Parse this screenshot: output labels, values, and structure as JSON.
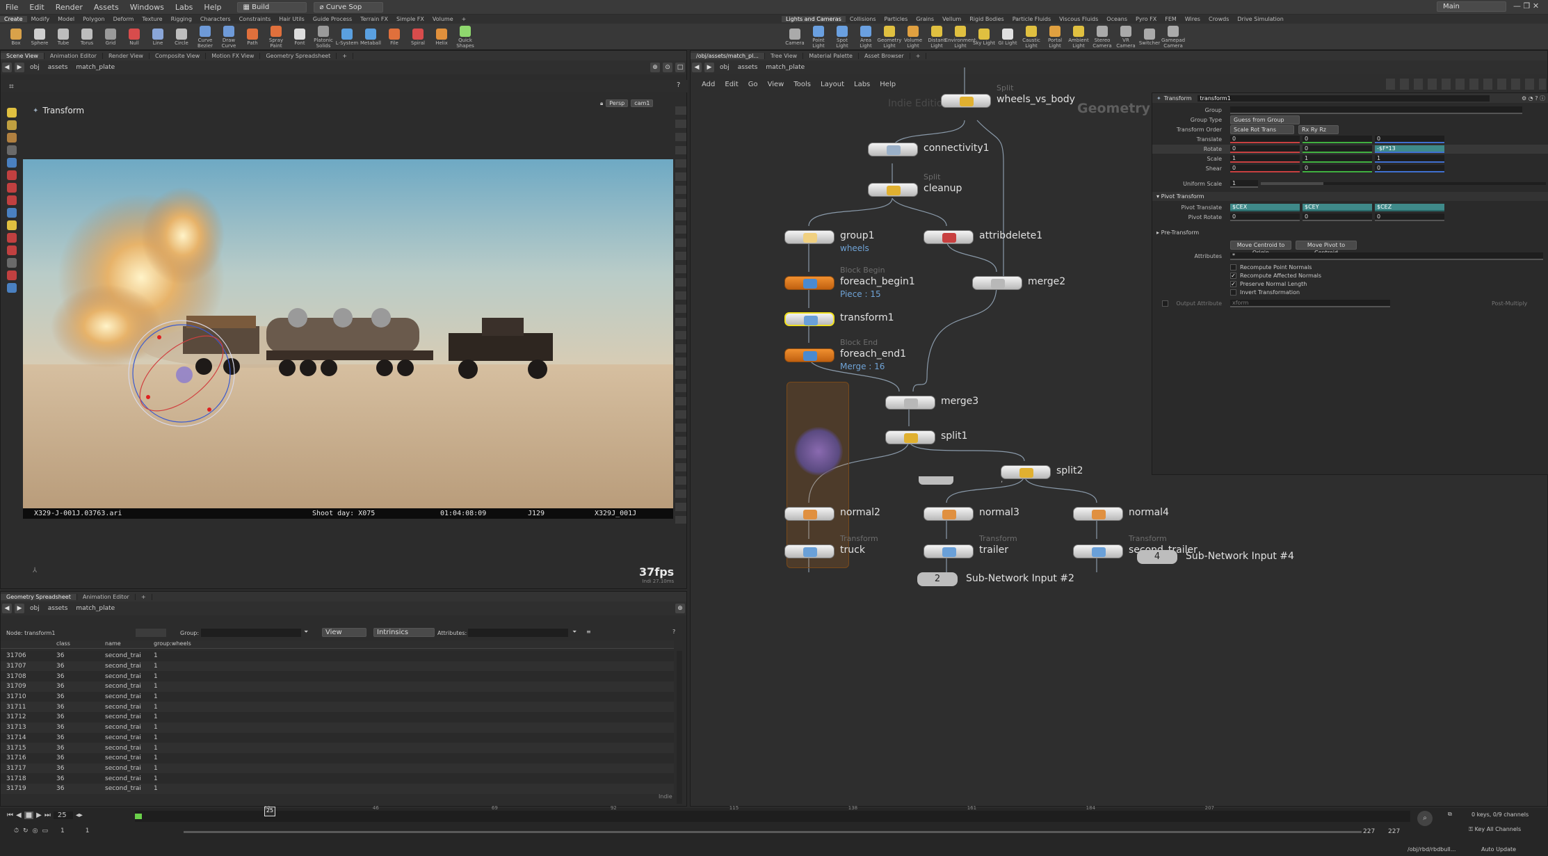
{
  "menubar": {
    "items": [
      "File",
      "Edit",
      "Render",
      "Assets",
      "Windows",
      "Labs",
      "Help"
    ],
    "build_label": "Build",
    "desk_label": "Curve Sop",
    "right_label": "Main"
  },
  "shelf": {
    "tabs_left": [
      "Create",
      "Modify",
      "Model",
      "Polygon",
      "Deform",
      "Texture",
      "Rigging",
      "Characters",
      "Constraints",
      "Hair Utils",
      "Guide Process",
      "Terrain FX",
      "Simple FX",
      "Volume"
    ],
    "tabs_right": [
      "Lights and Cameras",
      "Collisions",
      "Particles",
      "Grains",
      "Vellum",
      "Rigid Bodies",
      "Particle Fluids",
      "Viscous Fluids",
      "Oceans",
      "Pyro FX",
      "FEM",
      "Wires",
      "Crowds",
      "Drive Simulation"
    ],
    "tools_left": [
      {
        "label": "Box",
        "color": "#d9a24a"
      },
      {
        "label": "Sphere",
        "color": "#cfcfcf"
      },
      {
        "label": "Tube",
        "color": "#bdbdbd"
      },
      {
        "label": "Torus",
        "color": "#bdbdbd"
      },
      {
        "label": "Grid",
        "color": "#9a9a9a"
      },
      {
        "label": "Null",
        "color": "#d84c4c"
      },
      {
        "label": "Line",
        "color": "#8aa6d8"
      },
      {
        "label": "Circle",
        "color": "#bdbdbd"
      },
      {
        "label": "Curve Bezier",
        "color": "#6e9ad8"
      },
      {
        "label": "Draw Curve",
        "color": "#6e9ad8"
      },
      {
        "label": "Path",
        "color": "#e0703c"
      },
      {
        "label": "Spray Paint",
        "color": "#e0703c"
      },
      {
        "label": "Font",
        "color": "#dddddd"
      },
      {
        "label": "Platonic Solids",
        "color": "#9a9a9a"
      },
      {
        "label": "L-System",
        "color": "#5aa0e0"
      },
      {
        "label": "Metaball",
        "color": "#5aa0e0"
      },
      {
        "label": "File",
        "color": "#e0703c"
      },
      {
        "label": "Spiral",
        "color": "#d84c4c"
      },
      {
        "label": "Helix",
        "color": "#e0903c"
      },
      {
        "label": "Quick Shapes",
        "color": "#8fd86e"
      }
    ],
    "tools_right": [
      {
        "label": "Camera",
        "color": "#aaaaaa"
      },
      {
        "label": "Point Light",
        "color": "#6aa0e0"
      },
      {
        "label": "Spot Light",
        "color": "#6aa0e0"
      },
      {
        "label": "Area Light",
        "color": "#6aa0e0"
      },
      {
        "label": "Geometry Light",
        "color": "#e0c040"
      },
      {
        "label": "Volume Light",
        "color": "#e0a040"
      },
      {
        "label": "Distant Light",
        "color": "#e0c040"
      },
      {
        "label": "Environment Light",
        "color": "#e0c040"
      },
      {
        "label": "Sky Light",
        "color": "#e0c040"
      },
      {
        "label": "GI Light",
        "color": "#e0e0e0"
      },
      {
        "label": "Caustic Light",
        "color": "#e0c040"
      },
      {
        "label": "Portal Light",
        "color": "#e0a040"
      },
      {
        "label": "Ambient Light",
        "color": "#e0c040"
      },
      {
        "label": "Stereo Camera",
        "color": "#aaaaaa"
      },
      {
        "label": "VR Camera",
        "color": "#aaaaaa"
      },
      {
        "label": "Switcher",
        "color": "#aaaaaa"
      },
      {
        "label": "Gamepad Camera",
        "color": "#aaaaaa"
      }
    ]
  },
  "viewer": {
    "tabs": [
      "Scene View",
      "Animation Editor",
      "Render View",
      "Composite View",
      "Motion FX View",
      "Geometry Spreadsheet"
    ],
    "path": [
      "obj",
      "assets",
      "match_plate"
    ],
    "title": "Transform",
    "persp": "Persp",
    "cam": "cam1",
    "overlay_left": "X329-J-001J.03763.ari",
    "overlay_shootday": "Shoot day: X075",
    "overlay_timecode": "01:04:08:09",
    "overlay_j": "J129",
    "overlay_right": "X329J_001J",
    "fps": "37fps",
    "fps_sub1": "Indi",
    "fps_sub2": "27.10ms"
  },
  "spreadsheet": {
    "tabs": [
      "Geometry Spreadsheet",
      "Animation Editor"
    ],
    "path": [
      "obj",
      "assets",
      "match_plate"
    ],
    "node_label": "Node: transform1",
    "group_label": "Group:",
    "view_label": "View",
    "intrinsics_label": "Intrinsics",
    "attributes_label": "Attributes:",
    "columns": [
      "",
      "class",
      "name",
      "group:wheels"
    ],
    "rows": [
      [
        "31706",
        "36",
        "second_trai",
        "1"
      ],
      [
        "31707",
        "36",
        "second_trai",
        "1"
      ],
      [
        "31708",
        "36",
        "second_trai",
        "1"
      ],
      [
        "31709",
        "36",
        "second_trai",
        "1"
      ],
      [
        "31710",
        "36",
        "second_trai",
        "1"
      ],
      [
        "31711",
        "36",
        "second_trai",
        "1"
      ],
      [
        "31712",
        "36",
        "second_trai",
        "1"
      ],
      [
        "31713",
        "36",
        "second_trai",
        "1"
      ],
      [
        "31714",
        "36",
        "second_trai",
        "1"
      ],
      [
        "31715",
        "36",
        "second_trai",
        "1"
      ],
      [
        "31716",
        "36",
        "second_trai",
        "1"
      ],
      [
        "31717",
        "36",
        "second_trai",
        "1"
      ],
      [
        "31718",
        "36",
        "second_trai",
        "1"
      ],
      [
        "31719",
        "36",
        "second_trai",
        "1"
      ]
    ],
    "footer": "Indie"
  },
  "network": {
    "tabs": [
      "/obj/assets/match_pl...",
      "Tree View",
      "Material Palette",
      "Asset Browser"
    ],
    "path": [
      "obj",
      "assets",
      "match_plate"
    ],
    "menu": [
      "Add",
      "Edit",
      "Go",
      "View",
      "Tools",
      "Layout",
      "Labs",
      "Help"
    ],
    "watermark": "Indie Edition",
    "context": "Geometry",
    "nodes": [
      {
        "name": "wheels_vs_body",
        "type": "Split",
        "sub": "",
        "color": "#e0b030"
      },
      {
        "name": "connectivity1",
        "type": "",
        "sub": "",
        "color": "#9ab0c8"
      },
      {
        "name": "cleanup",
        "type": "Split",
        "sub": "",
        "color": "#e0b030"
      },
      {
        "name": "group1",
        "type": "",
        "sub": "wheels",
        "color": "#f0d080"
      },
      {
        "name": "attribdelete1",
        "type": "",
        "sub": "",
        "color": "#c84040"
      },
      {
        "name": "foreach_begin1",
        "type": "Block Begin",
        "sub": "Piece : 15",
        "color": "#4a8ad0"
      },
      {
        "name": "merge2",
        "type": "",
        "sub": "",
        "color": "#b8b8b8"
      },
      {
        "name": "transform1",
        "type": "",
        "sub": "",
        "color": "#6aa0d8"
      },
      {
        "name": "foreach_end1",
        "type": "Block End",
        "sub": "Merge : 16",
        "color": "#4a8ad0"
      },
      {
        "name": "merge3",
        "type": "",
        "sub": "",
        "color": "#b8b8b8"
      },
      {
        "name": "split1",
        "type": "",
        "sub": "",
        "color": "#e0b030"
      },
      {
        "name": "split2",
        "type": "",
        "sub": "",
        "color": "#e0b030"
      },
      {
        "name": "normal2",
        "type": "",
        "sub": "",
        "color": "#e09040"
      },
      {
        "name": "normal3",
        "type": "",
        "sub": "",
        "color": "#e09040"
      },
      {
        "name": "normal4",
        "type": "",
        "sub": "",
        "color": "#e09040"
      },
      {
        "name": "truck",
        "type": "Transform",
        "sub": "",
        "color": "#6aa0d8"
      },
      {
        "name": "trailer",
        "type": "Transform",
        "sub": "",
        "color": "#6aa0d8"
      },
      {
        "name": "second_trailer",
        "type": "Transform",
        "sub": "",
        "color": "#6aa0d8"
      }
    ],
    "subnet_inputs": [
      {
        "num": "4",
        "label": "Sub-Network Input #4"
      },
      {
        "num": "2",
        "label": "Sub-Network Input #2"
      }
    ]
  },
  "params": {
    "node_type": "Transform",
    "node_name": "transform1",
    "group_label": "Group",
    "group_type_label": "Group Type",
    "group_type_value": "Guess from Group",
    "transform_order_label": "Transform Order",
    "transform_order_value": "Scale Rot Trans",
    "rot_order_value": "Rx Ry Rz",
    "translate_label": "Translate",
    "translate": [
      "0",
      "0",
      "0"
    ],
    "rotate_label": "Rotate",
    "rotate": [
      "0",
      "0",
      "-$F*13"
    ],
    "scale_label": "Scale",
    "scale": [
      "1",
      "1",
      "1"
    ],
    "shear_label": "Shear",
    "shear": [
      "0",
      "0",
      "0"
    ],
    "uniform_scale_label": "Uniform Scale",
    "uniform_scale": "1",
    "uniform_scale_fraction": 0.22,
    "pivot_section": "Pivot Transform",
    "pivot_translate_label": "Pivot Translate",
    "pivot_translate": [
      "$CEX",
      "$CEY",
      "$CEZ"
    ],
    "pivot_rotate_label": "Pivot Rotate",
    "pivot_rotate": [
      "0",
      "0",
      "0"
    ],
    "pre_transform": "Pre-Transform",
    "move_centroid_btn": "Move Centroid to Origin",
    "move_pivot_btn": "Move Pivot to Centroid",
    "attributes_label": "Attributes",
    "attributes_value": "*",
    "checks": [
      {
        "label": "Recompute Point Normals",
        "checked": false
      },
      {
        "label": "Recompute Affected Normals",
        "checked": true
      },
      {
        "label": "Preserve Normal Length",
        "checked": true
      },
      {
        "label": "Invert Transformation",
        "checked": false
      }
    ],
    "output_attr_label": "Output Attribute",
    "output_attr_value": "xform",
    "post_multiply": "Post-Multiply"
  },
  "timeline": {
    "current_frame": "25",
    "start": "1",
    "start2": "1",
    "end": "227",
    "end2": "227",
    "ticks": [
      "25",
      "46",
      "69",
      "92",
      "115",
      "138",
      "161",
      "184",
      "207"
    ],
    "keys_label": "0 keys, 0/9 channels",
    "key_all": "Key All Channels",
    "path_status": "/obj/rbd/rbdbull...",
    "auto_update": "Auto Update"
  },
  "colors": {
    "accent_teal": "#3f8a8a",
    "node_orange": "#e07a1a",
    "selected_yellow": "#f0e020",
    "link_blue": "#6fa3d6"
  }
}
